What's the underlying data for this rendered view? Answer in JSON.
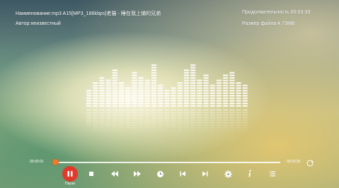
{
  "header": {
    "name_line": "Наименование:mp3 A15[MP3_186kbps]老猫 - 睡在我上铺的兄弟",
    "author_line": "Автор:неизвестный",
    "duration_line": "Продолжительность 00:03:33",
    "size_line": "Размер файла:4,73MB"
  },
  "playback": {
    "elapsed": "00:00:01",
    "total": "00:03:33",
    "progress_fraction": 0.005,
    "accent_color": "#f07a25",
    "pause_color": "#e03a2c",
    "pause_label": "Пауза"
  },
  "visualizer": {
    "levels": [
      7,
      10,
      12,
      11,
      15,
      10,
      8,
      14,
      12,
      11,
      17,
      9,
      7,
      8,
      10,
      15,
      17,
      11,
      13,
      9,
      11,
      13,
      14,
      10,
      9
    ]
  },
  "controls": [
    {
      "name": "pause-button",
      "icon": "pause-icon"
    },
    {
      "name": "stop-button",
      "icon": "stop-icon"
    },
    {
      "name": "rewind-button",
      "icon": "rewind-icon"
    },
    {
      "name": "fast-forward-button",
      "icon": "fast-forward-icon"
    },
    {
      "name": "timer-button",
      "icon": "clock-icon"
    },
    {
      "name": "previous-track-button",
      "icon": "skip-previous-icon"
    },
    {
      "name": "next-track-button",
      "icon": "skip-next-icon"
    },
    {
      "name": "settings-button",
      "icon": "gear-icon"
    },
    {
      "name": "info-button",
      "icon": "info-icon"
    },
    {
      "name": "playlist-button",
      "icon": "list-icon"
    }
  ]
}
